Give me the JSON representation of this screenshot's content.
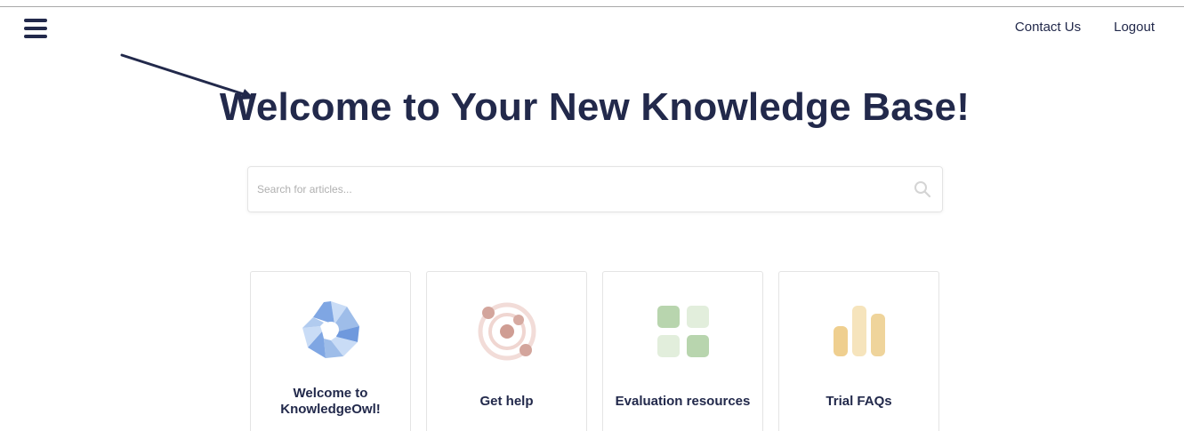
{
  "header": {
    "menu_icon": "hamburger-menu-icon",
    "nav": [
      {
        "label": "Contact Us"
      },
      {
        "label": "Logout"
      }
    ]
  },
  "hero": {
    "title": "Welcome to Your New Knowledge Base!"
  },
  "search": {
    "placeholder": "Search for articles...",
    "value": "",
    "icon": "search-icon"
  },
  "categories": [
    {
      "label": "Welcome to KnowledgeOwl!",
      "icon": "aperture-icon",
      "color": "#8fb3e8"
    },
    {
      "label": "Get help",
      "icon": "orbit-icon",
      "color": "#d8a8a0"
    },
    {
      "label": "Evaluation resources",
      "icon": "grid-icon",
      "color": "#b9d6b0"
    },
    {
      "label": "Trial FAQs",
      "icon": "bar-chart-icon",
      "color": "#efd49b"
    }
  ],
  "colors": {
    "primary_text": "#22294b",
    "border": "#e4e4e4"
  }
}
